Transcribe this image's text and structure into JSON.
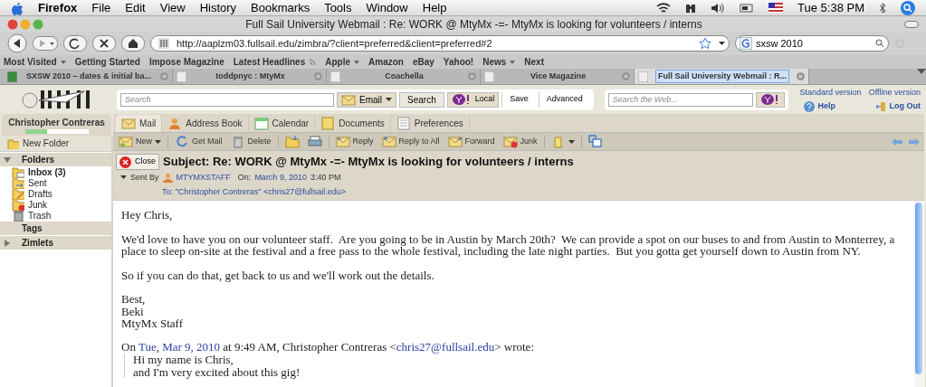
{
  "menu_bar": {
    "app": "Firefox",
    "items": [
      "File",
      "Edit",
      "View",
      "History",
      "Bookmarks",
      "Tools",
      "Window",
      "Help"
    ],
    "clock": "Tue 5:38 PM"
  },
  "window": {
    "title": "Full Sail University Webmail : Re: WORK @ MtyMx -=- MtyMx is looking for volunteers / interns"
  },
  "nav": {
    "url": "http://aaplzm03.fullsail.edu/zimbra/?client=preferred&client=preferred#2",
    "search": "sxsw 2010"
  },
  "bookmarks": [
    {
      "label": "Most Visited",
      "menu": true,
      "feed": false
    },
    {
      "label": "Getting Started",
      "menu": false,
      "feed": false
    },
    {
      "label": "Impose Magazine",
      "menu": false,
      "feed": false
    },
    {
      "label": "Latest Headlines",
      "menu": false,
      "feed": true
    },
    {
      "label": "Apple",
      "menu": true,
      "feed": false
    },
    {
      "label": "Amazon",
      "menu": false,
      "feed": false
    },
    {
      "label": "eBay",
      "menu": false,
      "feed": false
    },
    {
      "label": "Yahoo!",
      "menu": false,
      "feed": false
    },
    {
      "label": "News",
      "menu": true,
      "feed": false
    },
    {
      "label": "Next",
      "menu": false,
      "feed": false
    }
  ],
  "tabs": [
    {
      "label": "SXSW 2010 – dates & initial ba...",
      "selected": false
    },
    {
      "label": "toddpnyc : MtyMx",
      "selected": false
    },
    {
      "label": "Coachella",
      "selected": false
    },
    {
      "label": "Vice Magazine",
      "selected": false
    },
    {
      "label": "Full Sail University Webmail : R...",
      "selected": true
    }
  ],
  "header": {
    "search_placeholder": "Search",
    "search_type": "Email",
    "search_button": "Search",
    "local_button": "Local",
    "save": "Save",
    "advanced": "Advanced",
    "web_placeholder": "Search the Web...",
    "links": [
      "Standard version",
      "Offline version"
    ],
    "help": "Help",
    "logout": "Log Out"
  },
  "sidebar": {
    "user": "Christopher Contreras",
    "quota": {
      "level": 0.35
    },
    "new_folder": "New Folder",
    "sections": [
      {
        "label": "Folders",
        "expanded": true,
        "items": [
          {
            "label": "Inbox (3)",
            "kind": "inbox",
            "unread": true
          },
          {
            "label": "Sent",
            "kind": "sent",
            "unread": false
          },
          {
            "label": "Drafts",
            "kind": "drafts",
            "unread": false
          },
          {
            "label": "Junk",
            "kind": "junk",
            "unread": false
          },
          {
            "label": "Trash",
            "kind": "trash",
            "unread": false
          }
        ]
      },
      {
        "label": "Tags"
      },
      {
        "label": "Zimlets",
        "expanded": false
      }
    ]
  },
  "app_tabs": [
    {
      "label": "Mail",
      "kind": "mail",
      "selected": true
    },
    {
      "label": "Address Book",
      "kind": "contacts",
      "selected": false
    },
    {
      "label": "Calendar",
      "kind": "calendar",
      "selected": false
    },
    {
      "label": "Documents",
      "kind": "documents",
      "selected": false
    },
    {
      "label": "Preferences",
      "kind": "preferences",
      "selected": false
    }
  ],
  "toolbar": [
    {
      "kind": "new",
      "label": "New"
    },
    {
      "kind": "getmail",
      "label": "Get Mail"
    },
    {
      "kind": "delete",
      "label": "Delete"
    },
    {
      "kind": "move"
    },
    {
      "kind": "print"
    },
    {
      "kind": "reply",
      "label": "Reply"
    },
    {
      "kind": "replyall",
      "label": "Reply to All"
    },
    {
      "kind": "forward",
      "label": "Forward"
    },
    {
      "kind": "junk",
      "label": "Junk"
    },
    {
      "kind": "tag"
    },
    {
      "kind": "detach"
    }
  ],
  "message": {
    "close": "Close",
    "subject": "Subject: Re: WORK @ MtyMx -=- MtyMx is looking for volunteers / interns",
    "sent_by_label": "Sent By",
    "sender": "MTYMXSTAFF",
    "on_label": "On:",
    "date": "March 9, 2010",
    "time": "3:40 PM",
    "to": "To: \"Christopher Contreras\" <chris27@fullsail.edu>",
    "paragraphs": [
      "Hey Chris,",
      "We'd love to have you on our volunteer staff.  Are you going to be in Austin by March 20th?  We can provide a spot on our buses to and from Austin to Monterrey, a place to sleep on-site at the festival and a free pass to the whole festival, including the late night parties.  But you gotta get yourself down to Austin from NY.",
      "So if you can do that, get back to us and we'll work out the details.",
      "Best,\nBeki\nMtyMx Staff"
    ],
    "quote_intro": [
      {
        "text": "On ",
        "link": false
      },
      {
        "text": "Tue",
        "link": true
      },
      {
        "text": ", ",
        "link": false
      },
      {
        "text": "Mar 9, 2010",
        "link": true
      },
      {
        "text": " at 9:49 AM, Christopher Contreras <",
        "link": false
      },
      {
        "text": "chris27@fullsail.edu",
        "link": true
      },
      {
        "text": "> wrote:",
        "link": false
      }
    ],
    "quote": "Hi my name is Chris,\nand I'm very excited about this gig!"
  }
}
